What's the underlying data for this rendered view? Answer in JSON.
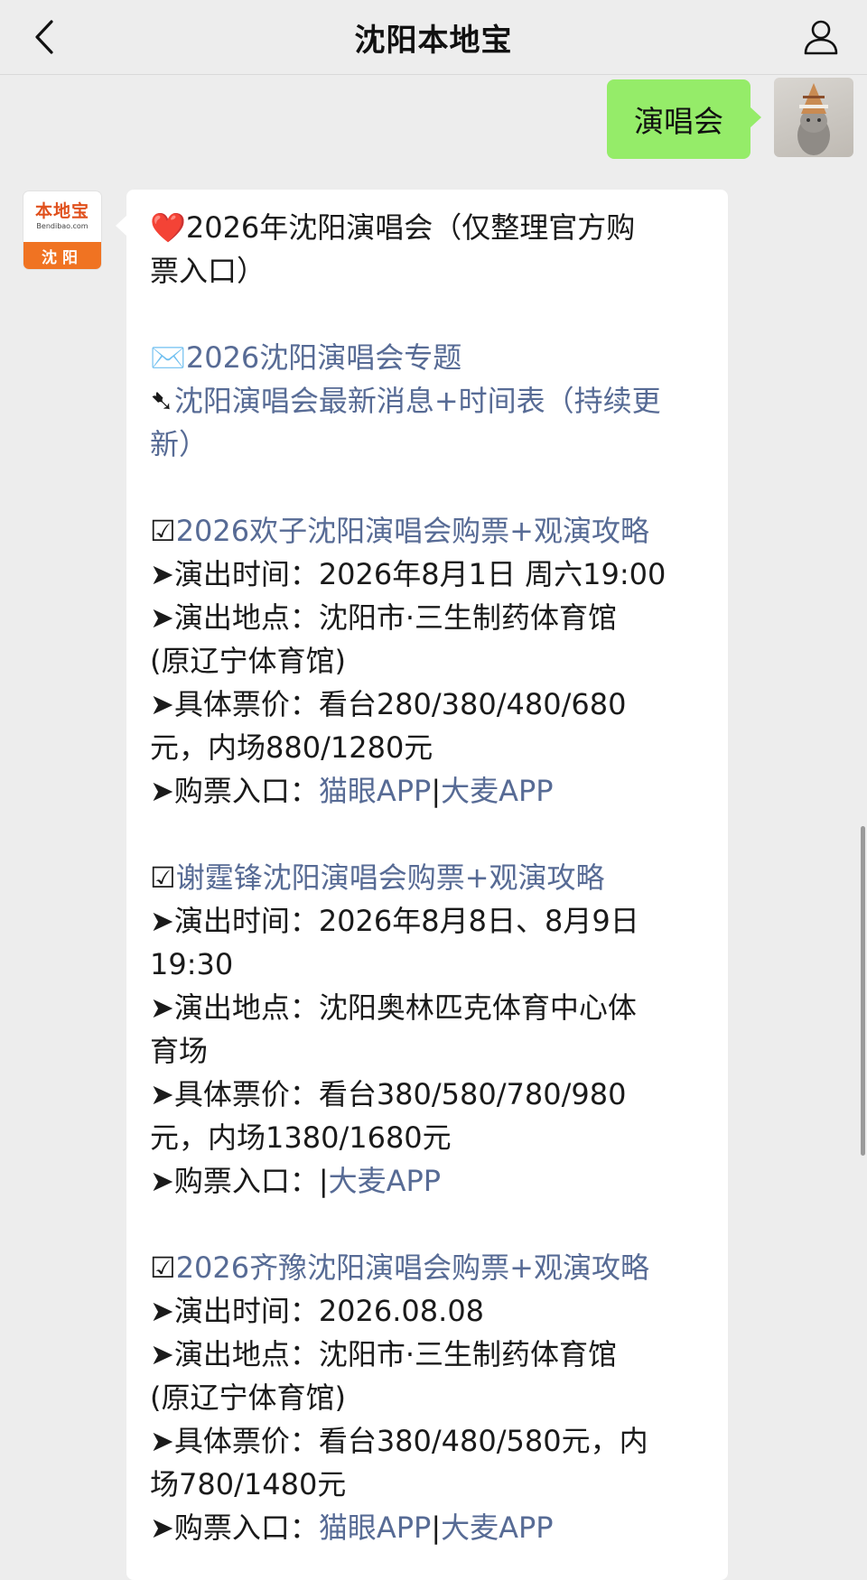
{
  "header": {
    "title": "沈阳本地宝",
    "back_icon": "chevron-left-icon",
    "profile_icon": "person-icon"
  },
  "outgoing_message": {
    "text": "演唱会",
    "bubble_color": "#95ec69"
  },
  "account_avatar": {
    "brand": "本地宝",
    "domain": "Bendibao.com",
    "city": "沈阳",
    "accent_color": "#f07322"
  },
  "article": {
    "heading": {
      "icon": "❤️",
      "lines": [
        "2026年沈阳演唱会（仅整理官方购",
        "票入口）"
      ]
    },
    "topic_link": {
      "icon": "✉️",
      "text": "2026沈阳演唱会专题"
    },
    "news_link": {
      "icon": "➷",
      "lines": [
        "沈阳演唱会最新消息+时间表（持续更",
        "新）"
      ]
    },
    "concerts": [
      {
        "title": "2026欢子沈阳演唱会购票+观演攻略",
        "time_lines": [
          "➤演出时间：2026年8月1日 周六19:00"
        ],
        "venue_lines": [
          "➤演出地点：沈阳市·三生制药体育馆",
          "(原辽宁体育馆)"
        ],
        "price_lines": [
          "➤具体票价：看台280/380/480/680",
          "元，内场880/1280元"
        ],
        "purchase_label": "➤购票入口：",
        "purchase_channels": [
          "猫眼APP",
          "大麦APP"
        ]
      },
      {
        "title": "谢霆锋沈阳演唱会购票+观演攻略",
        "time_lines": [
          "➤演出时间：2026年8月8日、8月9日",
          "19:30"
        ],
        "venue_lines": [
          "➤演出地点：沈阳奥林匹克体育中心体",
          "育场"
        ],
        "price_lines": [
          "➤具体票价：看台380/580/780/980",
          "元，内场1380/1680元"
        ],
        "purchase_label": "➤购票入口：",
        "purchase_channels": [
          "",
          "大麦APP"
        ]
      },
      {
        "title": "2026齐豫沈阳演唱会购票+观演攻略",
        "time_lines": [
          "➤演出时间：2026.08.08"
        ],
        "venue_lines": [
          "➤演出地点：沈阳市·三生制药体育馆",
          "(原辽宁体育馆)"
        ],
        "price_lines": [
          "➤具体票价：看台380/480/580元，内",
          "场780/1480元"
        ],
        "purchase_label": "➤购票入口：",
        "purchase_channels": [
          "猫眼APP",
          "大麦APP"
        ]
      }
    ],
    "checkbox_icon": "☑",
    "separator": "|",
    "link_color": "#576b95"
  }
}
